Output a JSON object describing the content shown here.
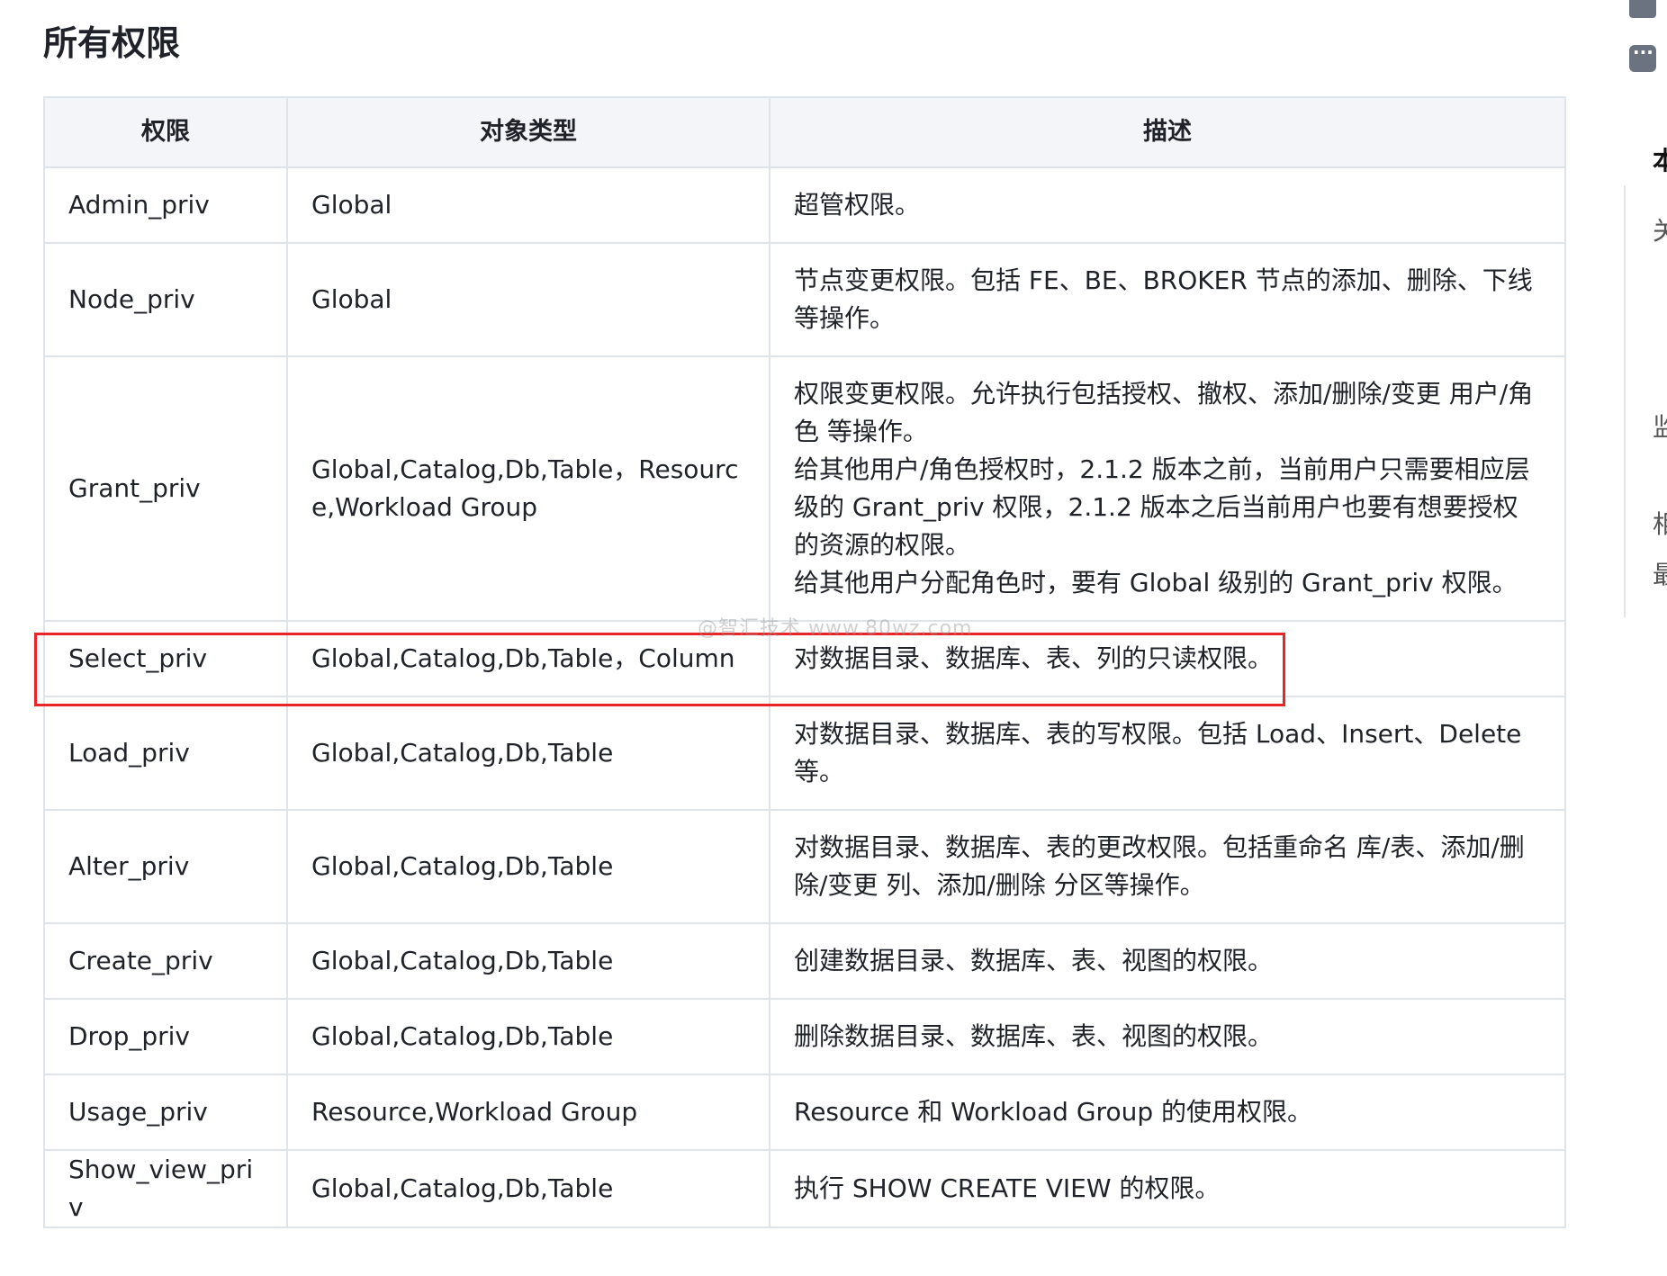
{
  "page": {
    "title": "所有权限",
    "watermark": "@智汇技术 www.80wz.com"
  },
  "table": {
    "headers": [
      "权限",
      "对象类型",
      "描述"
    ],
    "rows": [
      {
        "priv": "Admin_priv",
        "object": "Global",
        "desc": [
          "超管权限。"
        ]
      },
      {
        "priv": "Node_priv",
        "object": "Global",
        "desc": [
          "节点变更权限。包括 FE、BE、BROKER 节点的添加、删除、下线等操作。"
        ]
      },
      {
        "priv": "Grant_priv",
        "object": "Global,Catalog,Db,Table，Resource,Workload Group",
        "desc": [
          "权限变更权限。允许执行包括授权、撤权、添加/删除/变更 用户/角色 等操作。",
          "给其他用户/角色授权时，2.1.2 版本之前，当前用户只需要相应层级的 Grant_priv 权限，2.1.2 版本之后当前用户也要有想要授权的资源的权限。",
          "给其他用户分配角色时，要有 Global 级别的 Grant_priv 权限。"
        ]
      },
      {
        "priv": "Select_priv",
        "object": "Global,Catalog,Db,Table，Column",
        "desc": [
          "对数据目录、数据库、表、列的只读权限。"
        ]
      },
      {
        "priv": "Load_priv",
        "object": "Global,Catalog,Db,Table",
        "desc": [
          "对数据目录、数据库、表的写权限。包括 Load、Insert、Delete 等。"
        ]
      },
      {
        "priv": "Alter_priv",
        "object": "Global,Catalog,Db,Table",
        "desc": [
          "对数据目录、数据库、表的更改权限。包括重命名 库/表、添加/删除/变更 列、添加/删除 分区等操作。"
        ]
      },
      {
        "priv": "Create_priv",
        "object": "Global,Catalog,Db,Table",
        "desc": [
          "创建数据目录、数据库、表、视图的权限。"
        ]
      },
      {
        "priv": "Drop_priv",
        "object": "Global,Catalog,Db,Table",
        "desc": [
          "删除数据目录、数据库、表、视图的权限。"
        ]
      },
      {
        "priv": "Usage_priv",
        "object": "Resource,Workload Group",
        "desc": [
          "Resource 和 Workload Group 的使用权限。"
        ]
      },
      {
        "priv": "Show_view_priv",
        "object": "Global,Catalog,Db,Table",
        "desc": [
          "执行 SHOW CREATE VIEW 的权限。"
        ]
      }
    ]
  },
  "sidebar": {
    "chars": [
      "本",
      "关",
      "监",
      "相",
      "最"
    ]
  },
  "colors": {
    "highlight": "#e8262a",
    "header_bg": "#f3f5f8",
    "border": "#dfe3ea"
  }
}
